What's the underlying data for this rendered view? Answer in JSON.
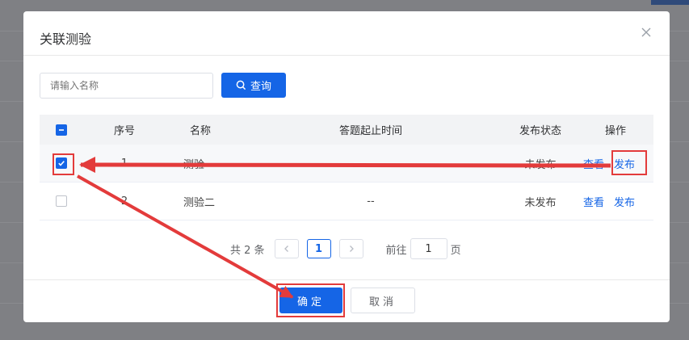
{
  "dialog": {
    "title": "关联测验",
    "search": {
      "placeholder": "请输入名称",
      "value": ""
    },
    "search_button": "查询",
    "table": {
      "headers": {
        "seq": "序号",
        "name": "名称",
        "time": "答题起止时间",
        "status": "发布状态",
        "ops": "操作"
      },
      "rows": [
        {
          "seq": "1",
          "name": "测验",
          "time": "",
          "status": "未发布",
          "view": "查看",
          "publish": "发布",
          "checked": true
        },
        {
          "seq": "2",
          "name": "测验二",
          "time": "--",
          "status": "未发布",
          "view": "查看",
          "publish": "发布",
          "checked": false
        }
      ]
    },
    "pagination": {
      "total": "共 2 条",
      "current_page": "1",
      "goto_prefix": "前往",
      "goto_value": "1",
      "goto_suffix": "页"
    },
    "confirm_button": "确定",
    "cancel_button": "取消"
  },
  "colors": {
    "primary": "#1565e6",
    "annotation": "#e33b3b",
    "overlay": "#7f8084"
  },
  "icons": {
    "close": "close-icon",
    "search": "search-icon",
    "prev": "chevron-left-icon",
    "next": "chevron-right-icon"
  }
}
